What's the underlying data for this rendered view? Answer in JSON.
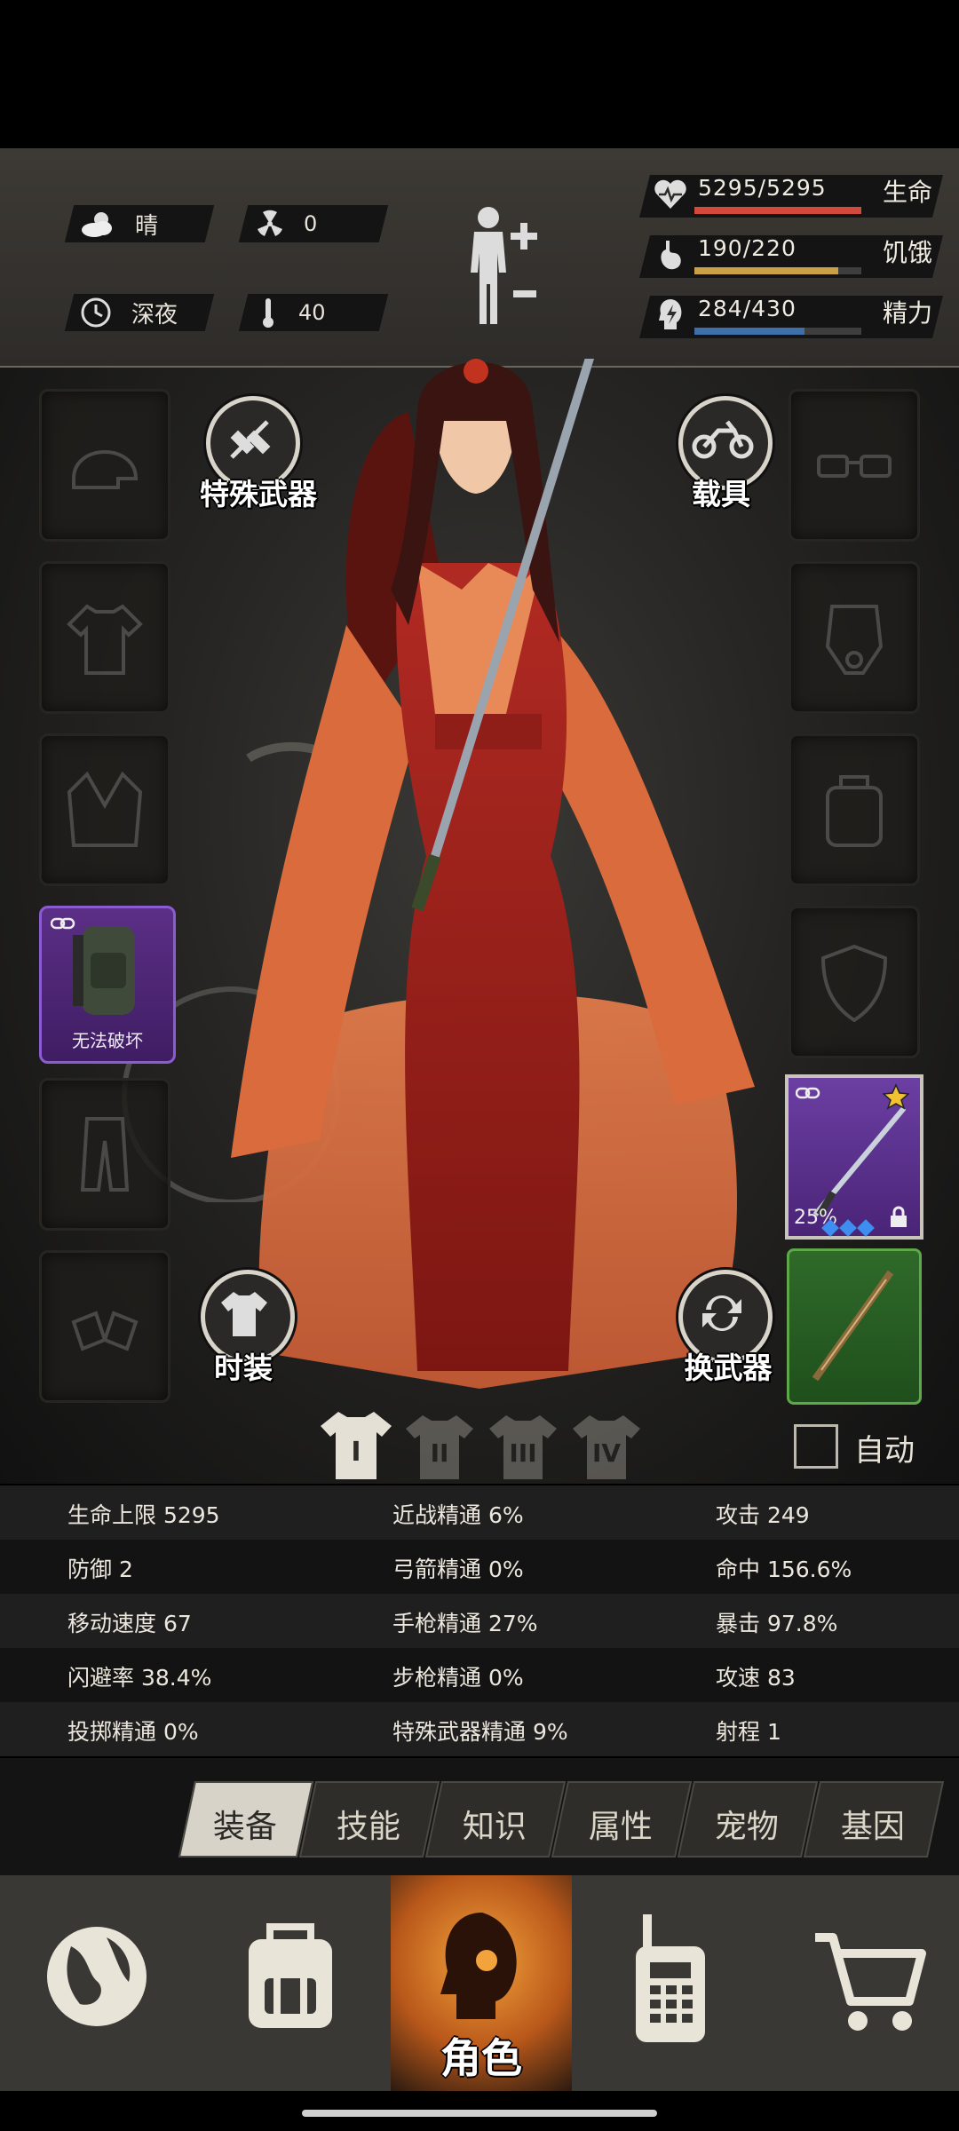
{
  "status": {
    "weather": "晴",
    "radiation": "0",
    "time_of_day": "深夜",
    "temperature": "40",
    "life": {
      "text": "5295/5295",
      "label": "生命",
      "fraction": 1.0,
      "color": "#d14a3c"
    },
    "hunger": {
      "text": "190/220",
      "label": "饥饿",
      "fraction": 0.864,
      "color": "#c9a045"
    },
    "energy": {
      "text": "284/430",
      "label": "精力",
      "fraction": 0.66,
      "color": "#3f6fa8"
    }
  },
  "character": {
    "special_weapon_label": "特殊武器",
    "vehicle_label": "载具",
    "fashion_label": "时装",
    "swap_weapon_label": "换武器",
    "backpack_label": "无法破坏",
    "weapon_percent": "25%",
    "auto_label": "自动",
    "loadout_tabs": [
      "I",
      "II",
      "III",
      "IV"
    ]
  },
  "stats": [
    [
      "生命上限 5295",
      "近战精通 6%",
      "攻击 249"
    ],
    [
      "防御 2",
      "弓箭精通 0%",
      "命中 156.6%"
    ],
    [
      "移动速度 67",
      "手枪精通 27%",
      "暴击 97.8%"
    ],
    [
      "闪避率 38.4%",
      "步枪精通 0%",
      "攻速 83"
    ],
    [
      "投掷精通 0%",
      "特殊武器精通 9%",
      "射程 1"
    ]
  ],
  "tabs": [
    "装备",
    "技能",
    "知识",
    "属性",
    "宠物",
    "基因"
  ],
  "active_tab": 0,
  "bottom_nav": {
    "active_label": "角色"
  },
  "icons": [
    "cloud-sun-icon",
    "radiation-icon",
    "clock-icon",
    "thermometer-icon",
    "heart-icon",
    "stomach-icon",
    "energy-head-icon",
    "body-icon",
    "globe-icon",
    "backpack-icon",
    "walkie-talkie-icon",
    "cart-icon"
  ]
}
